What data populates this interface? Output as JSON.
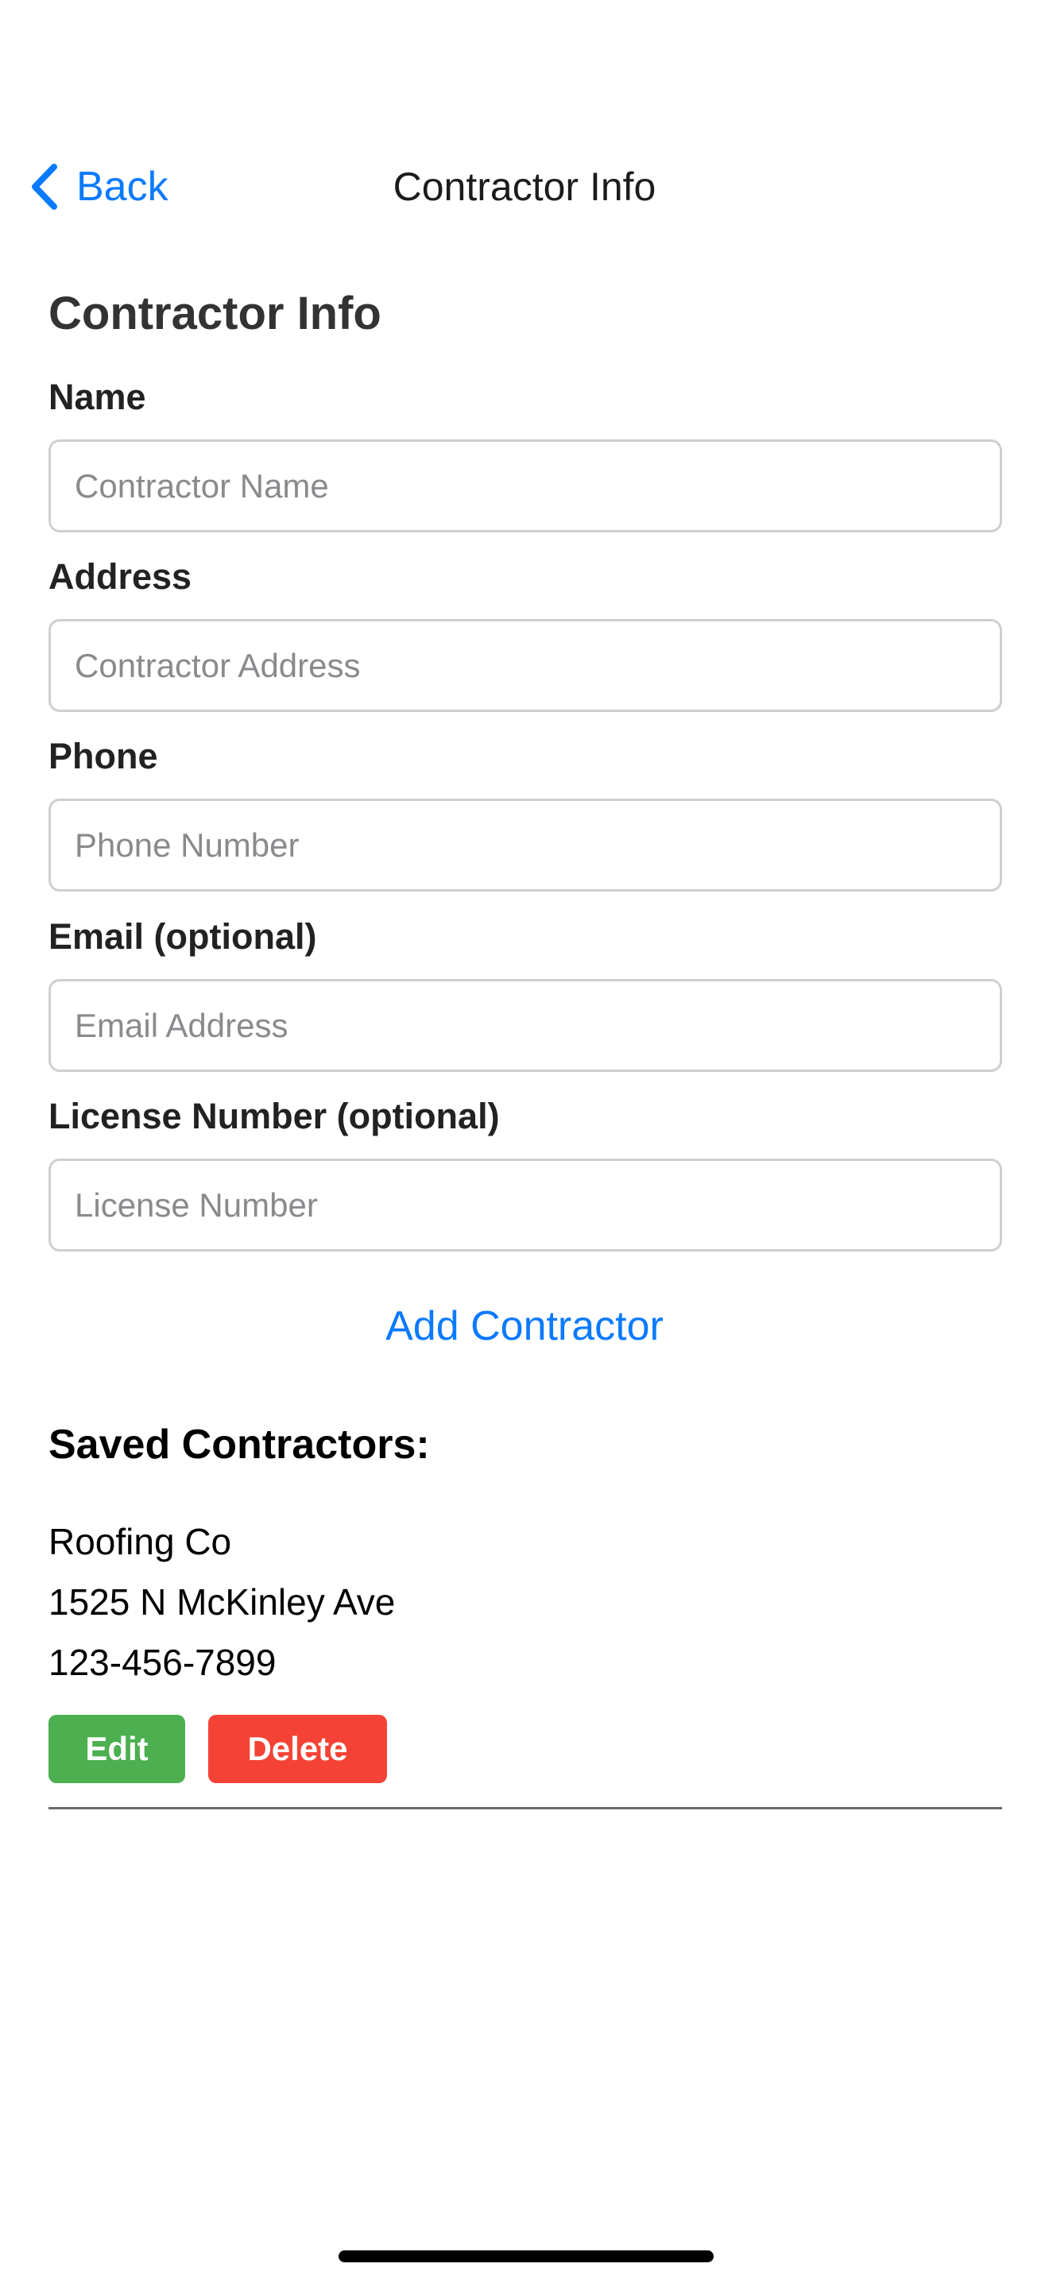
{
  "nav": {
    "back_label": "Back",
    "title": "Contractor Info"
  },
  "form": {
    "heading": "Contractor Info",
    "fields": [
      {
        "label": "Name",
        "placeholder": "Contractor Name",
        "value": ""
      },
      {
        "label": "Address",
        "placeholder": "Contractor Address",
        "value": ""
      },
      {
        "label": "Phone",
        "placeholder": "Phone Number",
        "value": ""
      },
      {
        "label": "Email (optional)",
        "placeholder": "Email Address",
        "value": ""
      },
      {
        "label": "License Number (optional)",
        "placeholder": "License Number",
        "value": ""
      }
    ],
    "submit_label": "Add Contractor"
  },
  "saved": {
    "heading": "Saved Contractors:",
    "contractors": [
      {
        "name": "Roofing Co",
        "address": "1525 N McKinley Ave",
        "phone": "123-456-7899",
        "edit_label": "Edit",
        "delete_label": "Delete"
      }
    ]
  },
  "icons": {
    "back": "chevron-left-icon"
  },
  "colors": {
    "accent": "#0a7aff",
    "edit": "#4caf50",
    "delete": "#f44336",
    "heading": "#333333",
    "input_border": "#cfcfd2",
    "placeholder": "#8a8a8e",
    "divider": "#6b6b6b"
  }
}
